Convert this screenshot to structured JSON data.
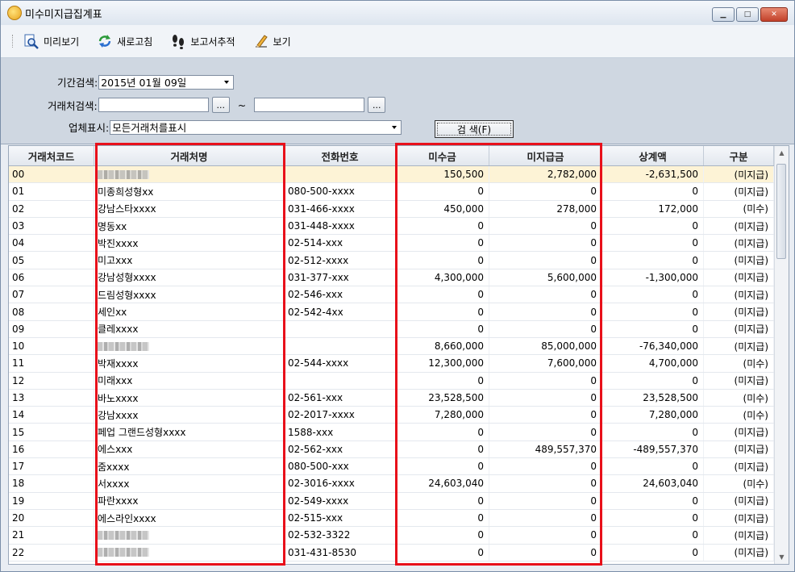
{
  "window": {
    "title": "미수미지급집계표"
  },
  "toolbar": {
    "preview": "미리보기",
    "refresh": "새로고침",
    "trace": "보고서추적",
    "view": "보기"
  },
  "filter": {
    "period_label": "기간검색:",
    "period_value": "2015년 01월 09일",
    "vendor_label": "거래처검색:",
    "vendor_from": "",
    "vendor_to": "",
    "range_sep": "~",
    "browse": "...",
    "display_label": "업체표시:",
    "display_value": "모든거래처를표시",
    "search_button": "검 색(F)"
  },
  "columns": [
    "거래처코드",
    "거래처명",
    "전화번호",
    "미수금",
    "미지급금",
    "상계액",
    "구분"
  ],
  "rows": [
    {
      "code": "00",
      "name": "",
      "phone": "",
      "ar": "150,500",
      "ap": "2,782,000",
      "net": "-2,631,500",
      "type": "(미지급)",
      "blur": true
    },
    {
      "code": "01",
      "name": "미종희성형xx",
      "phone": "080-500-xxxx",
      "ar": "0",
      "ap": "0",
      "net": "0",
      "type": "(미지급)"
    },
    {
      "code": "02",
      "name": "강남스타xxxx",
      "phone": "031-466-xxxx",
      "ar": "450,000",
      "ap": "278,000",
      "net": "172,000",
      "type": "(미수)"
    },
    {
      "code": "03",
      "name": "명동xx",
      "phone": "031-448-xxxx",
      "ar": "0",
      "ap": "0",
      "net": "0",
      "type": "(미지급)"
    },
    {
      "code": "04",
      "name": "박진xxxx",
      "phone": "02-514-xxx",
      "ar": "0",
      "ap": "0",
      "net": "0",
      "type": "(미지급)"
    },
    {
      "code": "05",
      "name": "미고xxx",
      "phone": "02-512-xxxx",
      "ar": "0",
      "ap": "0",
      "net": "0",
      "type": "(미지급)"
    },
    {
      "code": "06",
      "name": "강남성형xxxx",
      "phone": "031-377-xxx",
      "ar": "4,300,000",
      "ap": "5,600,000",
      "net": "-1,300,000",
      "type": "(미지급)"
    },
    {
      "code": "07",
      "name": "드림성형xxxx",
      "phone": "02-546-xxx",
      "ar": "0",
      "ap": "0",
      "net": "0",
      "type": "(미지급)"
    },
    {
      "code": "08",
      "name": "세인xx",
      "phone": "02-542-4xx",
      "ar": "0",
      "ap": "0",
      "net": "0",
      "type": "(미지급)"
    },
    {
      "code": "09",
      "name": "클레xxxx",
      "phone": "",
      "ar": "0",
      "ap": "0",
      "net": "0",
      "type": "(미지급)"
    },
    {
      "code": "10",
      "name": "",
      "phone": "",
      "ar": "8,660,000",
      "ap": "85,000,000",
      "net": "-76,340,000",
      "type": "(미지급)",
      "blur": true
    },
    {
      "code": "11",
      "name": "박재xxxx",
      "phone": "02-544-xxxx",
      "ar": "12,300,000",
      "ap": "7,600,000",
      "net": "4,700,000",
      "type": "(미수)"
    },
    {
      "code": "12",
      "name": "미래xxx",
      "phone": "",
      "ar": "0",
      "ap": "0",
      "net": "0",
      "type": "(미지급)"
    },
    {
      "code": "13",
      "name": "바노xxxx",
      "phone": "02-561-xxx",
      "ar": "23,528,500",
      "ap": "0",
      "net": "23,528,500",
      "type": "(미수)"
    },
    {
      "code": "14",
      "name": "강남xxxx",
      "phone": "02-2017-xxxx",
      "ar": "7,280,000",
      "ap": "0",
      "net": "7,280,000",
      "type": "(미수)"
    },
    {
      "code": "15",
      "name": "페업 그랜드성형xxxx",
      "phone": "1588-xxx",
      "ar": "0",
      "ap": "0",
      "net": "0",
      "type": "(미지급)"
    },
    {
      "code": "16",
      "name": "에스xxx",
      "phone": "02-562-xxx",
      "ar": "0",
      "ap": "489,557,370",
      "net": "-489,557,370",
      "type": "(미지급)"
    },
    {
      "code": "17",
      "name": "줌xxxx",
      "phone": "080-500-xxx",
      "ar": "0",
      "ap": "0",
      "net": "0",
      "type": "(미지급)"
    },
    {
      "code": "18",
      "name": "서xxxx",
      "phone": "02-3016-xxxx",
      "ar": "24,603,040",
      "ap": "0",
      "net": "24,603,040",
      "type": "(미수)"
    },
    {
      "code": "19",
      "name": "파란xxxx",
      "phone": "02-549-xxxx",
      "ar": "0",
      "ap": "0",
      "net": "0",
      "type": "(미지급)"
    },
    {
      "code": "20",
      "name": "에스라인xxxx",
      "phone": "02-515-xxx",
      "ar": "0",
      "ap": "0",
      "net": "0",
      "type": "(미지급)"
    },
    {
      "code": "21",
      "name": "",
      "phone": "02-532-3322",
      "ar": "0",
      "ap": "0",
      "net": "0",
      "type": "(미지급)",
      "blur": true
    },
    {
      "code": "22",
      "name": "",
      "phone": "031-431-8530",
      "ar": "0",
      "ap": "0",
      "net": "0",
      "type": "(미지급)",
      "blur": true
    }
  ],
  "colors": {
    "highlight": "#e8101a",
    "selected_row": "#fdf3d6",
    "filter_bg": "#cfd7e1"
  }
}
